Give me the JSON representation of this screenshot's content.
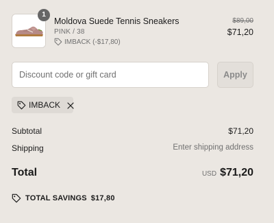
{
  "product": {
    "quantity": "1",
    "name": "Moldova Suede Tennis Sneakers",
    "variant": "PINK / 38",
    "discount_line": "IMBACK (-$17,80)",
    "original_price": "$89,00",
    "price": "$71,20",
    "image_icon": "sneaker-image"
  },
  "discount": {
    "placeholder": "Discount code or gift card",
    "value": "",
    "apply_label": "Apply"
  },
  "applied_code": {
    "label": "IMBACK",
    "tag_icon": "tag-icon",
    "remove_icon": "close-icon"
  },
  "totals": {
    "subtotal_label": "Subtotal",
    "subtotal_value": "$71,20",
    "shipping_label": "Shipping",
    "shipping_value": "Enter shipping address",
    "total_label": "Total",
    "total_currency": "USD",
    "total_value": "$71,20"
  },
  "savings": {
    "label": "TOTAL SAVINGS",
    "amount": "$17,80",
    "icon": "tag-icon"
  },
  "colors": {
    "background": "#ebe7e2",
    "text": "#1a1a1a",
    "muted_text": "#707070",
    "badge": "#666666",
    "chip_background": "#dedad5"
  }
}
